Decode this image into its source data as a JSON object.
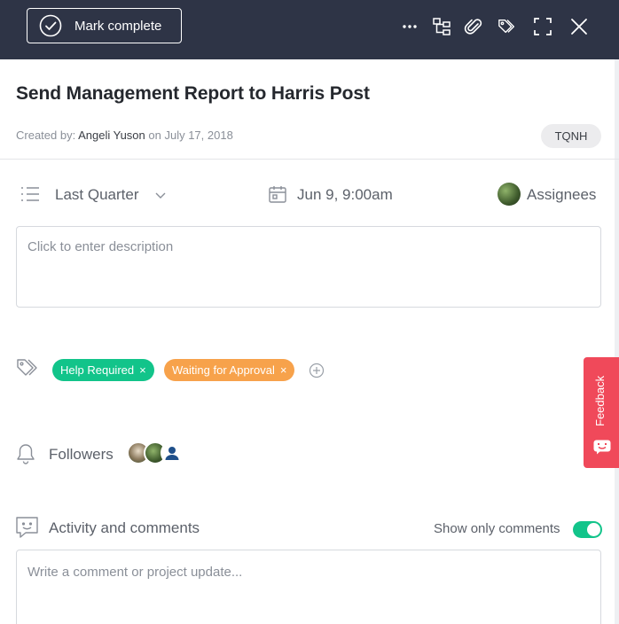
{
  "toolbar": {
    "mark_complete_label": "Mark complete",
    "icons": [
      "more-icon",
      "subtasks-icon",
      "attachment-icon",
      "tag-icon",
      "expand-icon",
      "close-icon"
    ]
  },
  "task": {
    "title": "Send Management Report to Harris Post",
    "created_prefix": "Created by: ",
    "created_by": "Angeli Yuson",
    "created_on_prefix": " on ",
    "created_date": "July 17, 2018",
    "code": "TQNH"
  },
  "meta": {
    "section": "Last Quarter",
    "due": "Jun 9, 9:00am",
    "assignees_label": "Assignees"
  },
  "description": {
    "placeholder": "Click to enter description"
  },
  "tags": [
    {
      "label": "Help Required",
      "color": "#12c48a"
    },
    {
      "label": "Waiting for Approval",
      "color": "#f7a24b"
    }
  ],
  "tag_remove_glyph": "×",
  "followers": {
    "label": "Followers",
    "count": 3
  },
  "activity": {
    "label": "Activity and comments",
    "show_only_comments_label": "Show only comments",
    "show_only_comments": true
  },
  "comment": {
    "placeholder": "Write a comment or project update..."
  },
  "feedback": {
    "label": "Feedback",
    "color": "#f0495a"
  },
  "colors": {
    "topbar": "#2e3446",
    "accent_green": "#12c48a"
  }
}
